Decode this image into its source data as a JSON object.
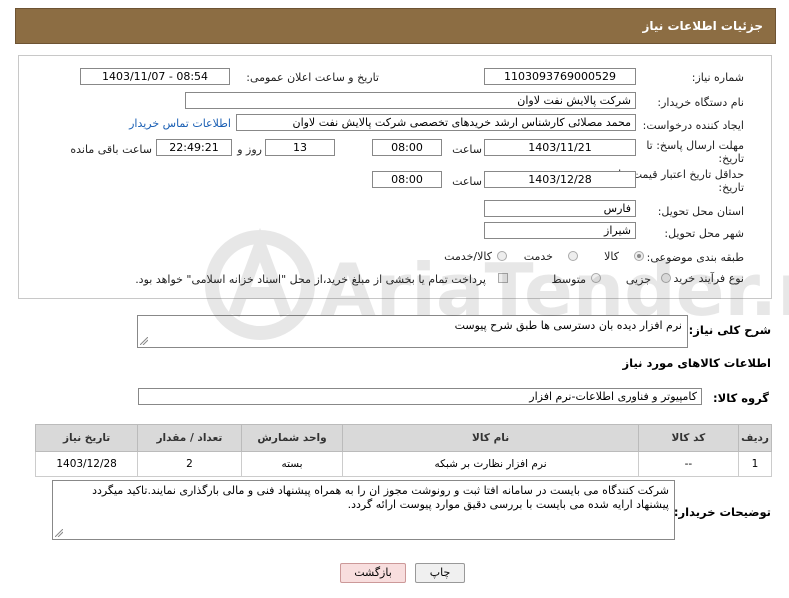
{
  "header": {
    "title": "جزئیات اطلاعات نیاز"
  },
  "fields": {
    "need_number_label": "شماره نیاز:",
    "need_number": "1103093769000529",
    "announce_label": "تاریخ و ساعت اعلان عمومی:",
    "announce_value": "1403/11/07 - 08:54",
    "buyer_org_label": "نام دستگاه خریدار:",
    "buyer_org": "شرکت پالایش نفت لاوان",
    "creator_label": "ایجاد کننده درخواست:",
    "creator": "محمد مصلائی کارشناس ارشد خریدهای تخصصی شرکت پالایش نفت لاوان",
    "contact_link": "اطلاعات تماس خریدار",
    "deadline_label_1": "مهلت ارسال پاسخ: تا",
    "deadline_label_2": "تاریخ:",
    "deadline_date": "1403/11/21",
    "time_label": "ساعت",
    "deadline_time": "08:00",
    "days_value": "13",
    "days_label": "روز و",
    "remaining_time": "22:49:21",
    "remaining_label": "ساعت باقی مانده",
    "validity_label_1": "حداقل تاریخ اعتبار قیمت: تا",
    "validity_label_2": "تاریخ:",
    "validity_date": "1403/12/28",
    "validity_time": "08:00",
    "province_label": "استان محل تحویل:",
    "province": "فارس",
    "city_label": "شهر محل تحویل:",
    "city": "شیراز",
    "category_label": "طبقه بندی موضوعی:",
    "category_options": [
      "کالا",
      "خدمت",
      "کالا/خدمت"
    ],
    "process_label": "نوع فرآیند خرید :",
    "process_options": [
      "جزیی",
      "متوسط"
    ],
    "payment_note": "پرداخت تمام یا بخشی از مبلغ خرید،از محل \"اسناد خزانه اسلامی\" خواهد بود."
  },
  "description": {
    "label": "شرح کلی نیاز:",
    "text": "نرم افزار دیده بان دسترسی ها طبق شرح پیوست"
  },
  "goods_info": {
    "title": "اطلاعات کالاهای مورد نیاز",
    "group_label": "گروه کالا:",
    "group_value": "کامپیوتر و فناوری اطلاعات-نرم افزار"
  },
  "table": {
    "headers": [
      "ردیف",
      "کد کالا",
      "نام کالا",
      "واحد شمارش",
      "تعداد / مقدار",
      "تاریخ نیاز"
    ],
    "rows": [
      [
        "1",
        "--",
        "نرم افزار نظارت بر شبکه",
        "بسته",
        "2",
        "1403/12/28"
      ]
    ]
  },
  "buyer_notes": {
    "label": "توضیحات خریدار:",
    "text": "شرکت کنندگاه می بایست در سامانه افتا ثبت و رونوشت مجوز ان را به همراه پیشنهاد فنی و مالی بارگذاری نمایند.تاکید میگردد پیشنهاد ارایه شده می بایست با بررسی دقیق موارد پیوست ارائه گردد."
  },
  "buttons": {
    "print": "چاپ",
    "back": "بازگشت"
  },
  "watermark": {
    "text": "AriaTender.neT"
  },
  "colors": {
    "header_bg": "#8c6d43",
    "link": "#1a5fb4",
    "back_button_bg": "#f8dede"
  }
}
